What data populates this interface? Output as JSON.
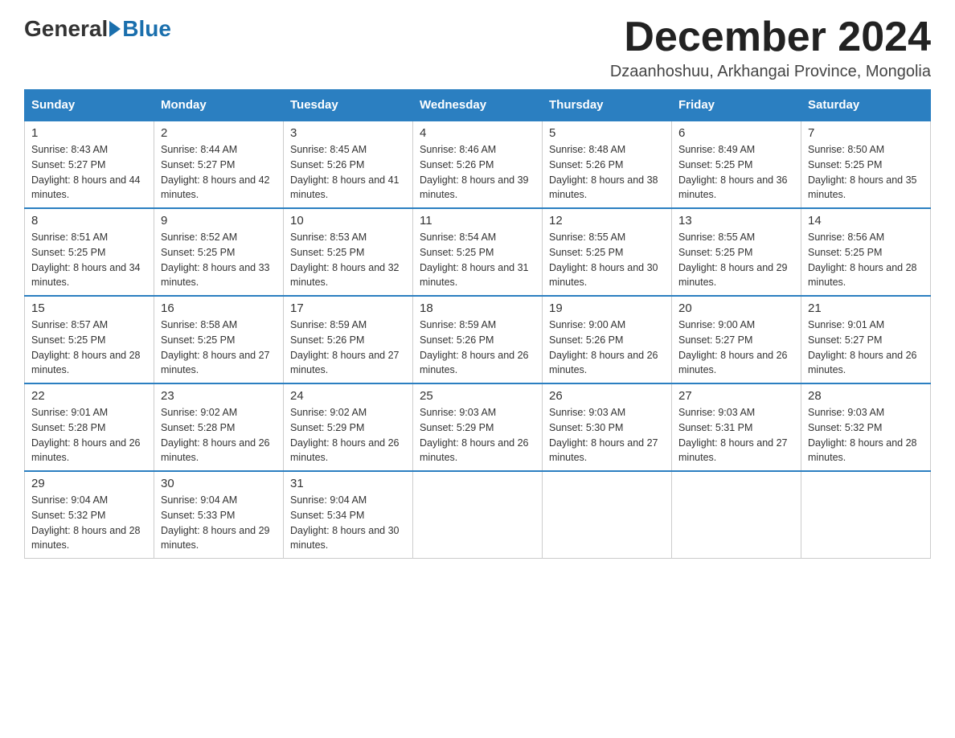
{
  "header": {
    "logo_general": "General",
    "logo_blue": "Blue",
    "month_title": "December 2024",
    "location": "Dzaanhoshuu, Arkhangai Province, Mongolia"
  },
  "weekdays": [
    "Sunday",
    "Monday",
    "Tuesday",
    "Wednesday",
    "Thursday",
    "Friday",
    "Saturday"
  ],
  "weeks": [
    [
      {
        "day": "1",
        "sunrise": "8:43 AM",
        "sunset": "5:27 PM",
        "daylight": "8 hours and 44 minutes."
      },
      {
        "day": "2",
        "sunrise": "8:44 AM",
        "sunset": "5:27 PM",
        "daylight": "8 hours and 42 minutes."
      },
      {
        "day": "3",
        "sunrise": "8:45 AM",
        "sunset": "5:26 PM",
        "daylight": "8 hours and 41 minutes."
      },
      {
        "day": "4",
        "sunrise": "8:46 AM",
        "sunset": "5:26 PM",
        "daylight": "8 hours and 39 minutes."
      },
      {
        "day": "5",
        "sunrise": "8:48 AM",
        "sunset": "5:26 PM",
        "daylight": "8 hours and 38 minutes."
      },
      {
        "day": "6",
        "sunrise": "8:49 AM",
        "sunset": "5:25 PM",
        "daylight": "8 hours and 36 minutes."
      },
      {
        "day": "7",
        "sunrise": "8:50 AM",
        "sunset": "5:25 PM",
        "daylight": "8 hours and 35 minutes."
      }
    ],
    [
      {
        "day": "8",
        "sunrise": "8:51 AM",
        "sunset": "5:25 PM",
        "daylight": "8 hours and 34 minutes."
      },
      {
        "day": "9",
        "sunrise": "8:52 AM",
        "sunset": "5:25 PM",
        "daylight": "8 hours and 33 minutes."
      },
      {
        "day": "10",
        "sunrise": "8:53 AM",
        "sunset": "5:25 PM",
        "daylight": "8 hours and 32 minutes."
      },
      {
        "day": "11",
        "sunrise": "8:54 AM",
        "sunset": "5:25 PM",
        "daylight": "8 hours and 31 minutes."
      },
      {
        "day": "12",
        "sunrise": "8:55 AM",
        "sunset": "5:25 PM",
        "daylight": "8 hours and 30 minutes."
      },
      {
        "day": "13",
        "sunrise": "8:55 AM",
        "sunset": "5:25 PM",
        "daylight": "8 hours and 29 minutes."
      },
      {
        "day": "14",
        "sunrise": "8:56 AM",
        "sunset": "5:25 PM",
        "daylight": "8 hours and 28 minutes."
      }
    ],
    [
      {
        "day": "15",
        "sunrise": "8:57 AM",
        "sunset": "5:25 PM",
        "daylight": "8 hours and 28 minutes."
      },
      {
        "day": "16",
        "sunrise": "8:58 AM",
        "sunset": "5:25 PM",
        "daylight": "8 hours and 27 minutes."
      },
      {
        "day": "17",
        "sunrise": "8:59 AM",
        "sunset": "5:26 PM",
        "daylight": "8 hours and 27 minutes."
      },
      {
        "day": "18",
        "sunrise": "8:59 AM",
        "sunset": "5:26 PM",
        "daylight": "8 hours and 26 minutes."
      },
      {
        "day": "19",
        "sunrise": "9:00 AM",
        "sunset": "5:26 PM",
        "daylight": "8 hours and 26 minutes."
      },
      {
        "day": "20",
        "sunrise": "9:00 AM",
        "sunset": "5:27 PM",
        "daylight": "8 hours and 26 minutes."
      },
      {
        "day": "21",
        "sunrise": "9:01 AM",
        "sunset": "5:27 PM",
        "daylight": "8 hours and 26 minutes."
      }
    ],
    [
      {
        "day": "22",
        "sunrise": "9:01 AM",
        "sunset": "5:28 PM",
        "daylight": "8 hours and 26 minutes."
      },
      {
        "day": "23",
        "sunrise": "9:02 AM",
        "sunset": "5:28 PM",
        "daylight": "8 hours and 26 minutes."
      },
      {
        "day": "24",
        "sunrise": "9:02 AM",
        "sunset": "5:29 PM",
        "daylight": "8 hours and 26 minutes."
      },
      {
        "day": "25",
        "sunrise": "9:03 AM",
        "sunset": "5:29 PM",
        "daylight": "8 hours and 26 minutes."
      },
      {
        "day": "26",
        "sunrise": "9:03 AM",
        "sunset": "5:30 PM",
        "daylight": "8 hours and 27 minutes."
      },
      {
        "day": "27",
        "sunrise": "9:03 AM",
        "sunset": "5:31 PM",
        "daylight": "8 hours and 27 minutes."
      },
      {
        "day": "28",
        "sunrise": "9:03 AM",
        "sunset": "5:32 PM",
        "daylight": "8 hours and 28 minutes."
      }
    ],
    [
      {
        "day": "29",
        "sunrise": "9:04 AM",
        "sunset": "5:32 PM",
        "daylight": "8 hours and 28 minutes."
      },
      {
        "day": "30",
        "sunrise": "9:04 AM",
        "sunset": "5:33 PM",
        "daylight": "8 hours and 29 minutes."
      },
      {
        "day": "31",
        "sunrise": "9:04 AM",
        "sunset": "5:34 PM",
        "daylight": "8 hours and 30 minutes."
      },
      null,
      null,
      null,
      null
    ]
  ]
}
